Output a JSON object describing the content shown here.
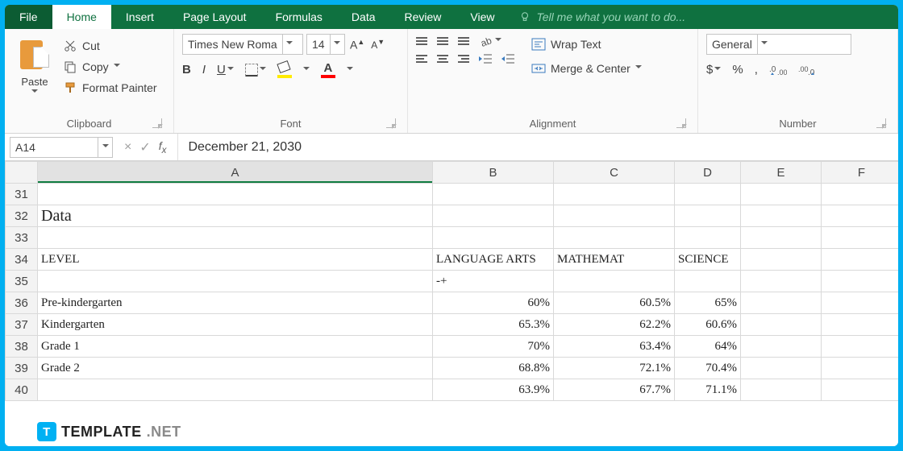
{
  "tabs": {
    "file": "File",
    "home": "Home",
    "insert": "Insert",
    "pageLayout": "Page Layout",
    "formulas": "Formulas",
    "data": "Data",
    "review": "Review",
    "view": "View",
    "tell": "Tell me what you want to do..."
  },
  "ribbon": {
    "clipboard": {
      "paste": "Paste",
      "cut": "Cut",
      "copy": "Copy",
      "formatPainter": "Format Painter",
      "label": "Clipboard"
    },
    "font": {
      "name": "Times New Roma",
      "size": "14",
      "bold": "B",
      "italic": "I",
      "underline": "U",
      "fontColorLetter": "A",
      "label": "Font"
    },
    "alignment": {
      "wrap": "Wrap Text",
      "merge": "Merge & Center",
      "label": "Alignment"
    },
    "number": {
      "format": "General",
      "dollar": "$",
      "percent": "%",
      "comma": ",",
      "label": "Number"
    }
  },
  "namebox": "A14",
  "formula": "December 21, 2030",
  "columns": [
    "A",
    "B",
    "C",
    "D",
    "E",
    "F"
  ],
  "rows": [
    {
      "n": "31",
      "A": "",
      "B": "",
      "C": "",
      "D": ""
    },
    {
      "n": "32",
      "A": "Data",
      "B": "",
      "C": "",
      "D": "",
      "big": true
    },
    {
      "n": "33",
      "A": "",
      "B": "",
      "C": "",
      "D": ""
    },
    {
      "n": "34",
      "A": "LEVEL",
      "B": "LANGUAGE ARTS",
      "C": "MATHEMAT",
      "D": "SCIENCE"
    },
    {
      "n": "35",
      "A": "",
      "B": "-+",
      "C": "",
      "D": "",
      "bleft": true
    },
    {
      "n": "36",
      "A": "Pre-kindergarten",
      "B": "60%",
      "C": "60.5%",
      "D": "65%"
    },
    {
      "n": "37",
      "A": "Kindergarten",
      "B": "65.3%",
      "C": "62.2%",
      "D": "60.6%"
    },
    {
      "n": "38",
      "A": "Grade 1",
      "B": "70%",
      "C": "63.4%",
      "D": "64%"
    },
    {
      "n": "39",
      "A": "Grade 2",
      "B": "68.8%",
      "C": "72.1%",
      "D": "70.4%"
    },
    {
      "n": "40",
      "A": "",
      "B": "63.9%",
      "C": "67.7%",
      "D": "71.1%"
    }
  ],
  "watermark": {
    "t": "T",
    "name": "TEMPLATE",
    "net": ".NET"
  },
  "chart_data": {
    "type": "table",
    "title": "Data",
    "columns": [
      "LEVEL",
      "LANGUAGE ARTS",
      "MATHEMATICS",
      "SCIENCE"
    ],
    "rows": [
      {
        "LEVEL": "Pre-kindergarten",
        "LANGUAGE ARTS": 60,
        "MATHEMATICS": 60.5,
        "SCIENCE": 65
      },
      {
        "LEVEL": "Kindergarten",
        "LANGUAGE ARTS": 65.3,
        "MATHEMATICS": 62.2,
        "SCIENCE": 60.6
      },
      {
        "LEVEL": "Grade 1",
        "LANGUAGE ARTS": 70,
        "MATHEMATICS": 63.4,
        "SCIENCE": 64
      },
      {
        "LEVEL": "Grade 2",
        "LANGUAGE ARTS": 68.8,
        "MATHEMATICS": 72.1,
        "SCIENCE": 70.4
      },
      {
        "LEVEL": "",
        "LANGUAGE ARTS": 63.9,
        "MATHEMATICS": 67.7,
        "SCIENCE": 71.1
      }
    ],
    "unit": "percent"
  }
}
